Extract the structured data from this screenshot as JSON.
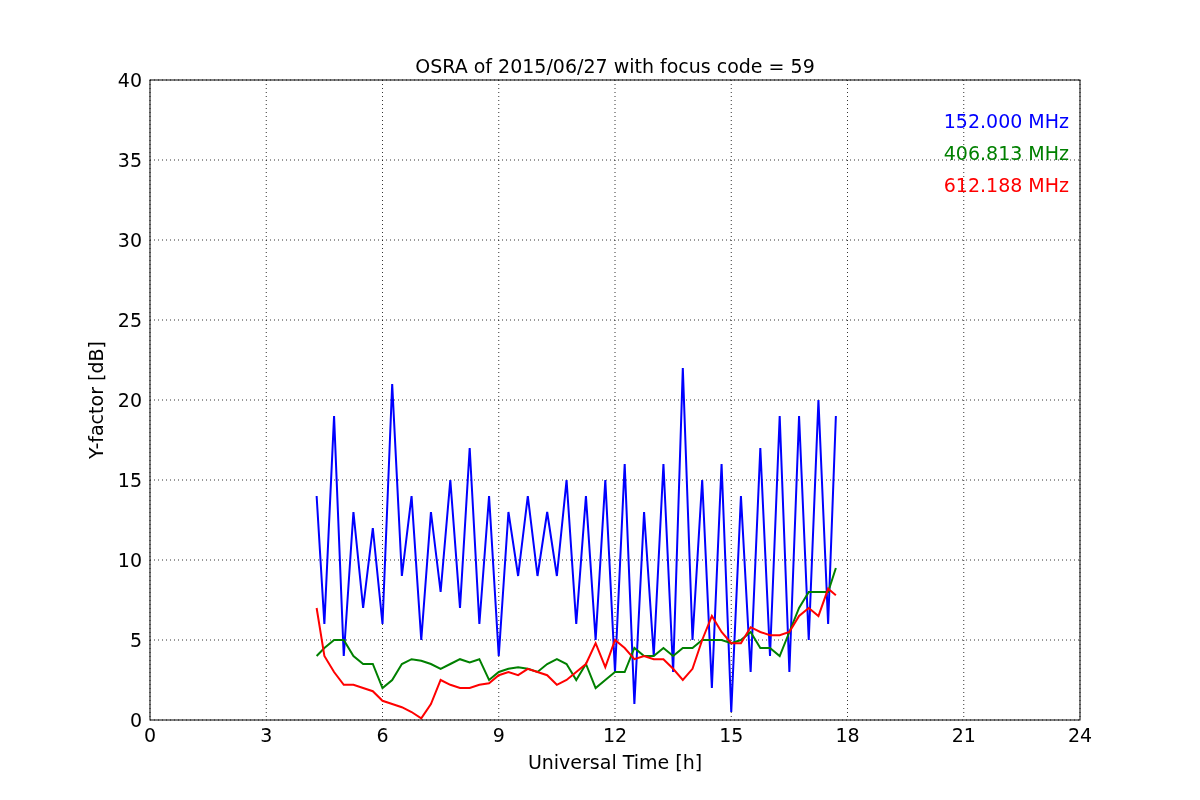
{
  "chart_data": {
    "type": "line",
    "title": "OSRA of 2015/06/27 with focus code = 59",
    "xlabel": "Universal Time [h]",
    "ylabel": "Y-factor [dB]",
    "grid": true,
    "xlim": [
      0,
      24
    ],
    "ylim": [
      0,
      40
    ],
    "xticks": [
      0,
      3,
      6,
      9,
      12,
      15,
      18,
      21,
      24
    ],
    "yticks": [
      0,
      5,
      10,
      15,
      20,
      25,
      30,
      35,
      40
    ],
    "x": [
      4.3,
      4.5,
      4.75,
      5,
      5.25,
      5.5,
      5.75,
      6,
      6.25,
      6.5,
      6.75,
      7,
      7.25,
      7.5,
      7.75,
      8,
      8.25,
      8.5,
      8.75,
      9,
      9.25,
      9.5,
      9.75,
      10,
      10.25,
      10.5,
      10.75,
      11,
      11.25,
      11.5,
      11.75,
      12,
      12.25,
      12.5,
      12.75,
      13,
      13.25,
      13.5,
      13.75,
      14,
      14.25,
      14.5,
      14.75,
      15,
      15.25,
      15.5,
      15.75,
      16,
      16.25,
      16.5,
      16.75,
      17,
      17.25,
      17.5,
      17.7
    ],
    "series": [
      {
        "name": "152.000 MHz",
        "color": "#0000ff",
        "values": [
          14,
          6,
          19,
          4,
          13,
          7,
          12,
          6,
          21,
          9,
          14,
          5,
          13,
          8,
          15,
          7,
          17,
          6,
          14,
          4,
          13,
          9,
          14,
          9,
          13,
          9,
          15,
          6,
          14,
          5,
          15,
          3,
          16,
          1,
          13,
          4,
          16,
          3,
          22,
          5,
          15,
          2,
          16,
          0.5,
          14,
          3,
          17,
          4,
          19,
          3,
          19,
          5,
          20,
          6,
          19
        ]
      },
      {
        "name": "406.813 MHz",
        "color": "#008000",
        "values": [
          4,
          4.5,
          5,
          5,
          4,
          3.5,
          3.5,
          2,
          2.5,
          3.5,
          3.8,
          3.7,
          3.5,
          3.2,
          3.5,
          3.8,
          3.6,
          3.8,
          2.5,
          3,
          3.2,
          3.3,
          3.2,
          3,
          3.5,
          3.8,
          3.5,
          2.5,
          3.5,
          2,
          2.5,
          3,
          3,
          4.5,
          4,
          4,
          4.5,
          4,
          4.5,
          4.5,
          5,
          5,
          5,
          4.8,
          5,
          5.5,
          4.5,
          4.5,
          4,
          5.5,
          7,
          8,
          8,
          8,
          9.5
        ]
      },
      {
        "name": "612.188 MHz",
        "color": "#ff0000",
        "values": [
          7,
          4,
          3,
          2.2,
          2.2,
          2,
          1.8,
          1.2,
          1,
          0.8,
          0.5,
          0.1,
          1,
          2.5,
          2.2,
          2,
          2,
          2.2,
          2.3,
          2.8,
          3,
          2.8,
          3.2,
          3,
          2.8,
          2.2,
          2.5,
          3,
          3.5,
          4.8,
          3.3,
          5,
          4.5,
          3.8,
          4,
          3.8,
          3.8,
          3.2,
          2.5,
          3.2,
          5,
          6.5,
          5.5,
          4.8,
          4.8,
          5.8,
          5.5,
          5.3,
          5.3,
          5.5,
          6.5,
          7,
          6.5,
          8.2,
          7.8
        ]
      }
    ]
  }
}
